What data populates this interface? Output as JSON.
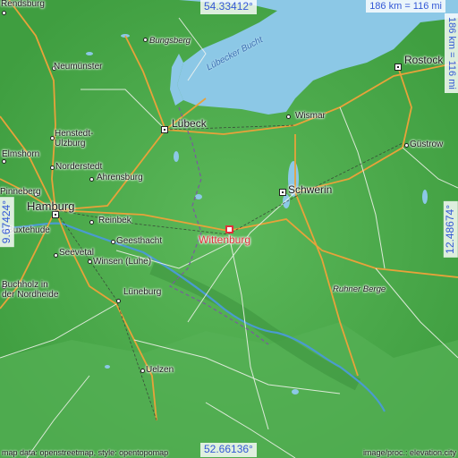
{
  "places": {
    "rendsburg": "Rendsburg",
    "bungsberg": "Bungsberg",
    "neumuenster": "Neumünster",
    "luebeck": "Lübeck",
    "henstedt": "Henstedt-\nUlzburg",
    "elmshorn": "Elmshorn",
    "norderstedt": "Norderstedt",
    "ahrensburg": "Ahrensburg",
    "pinneberg": "Pinneberg",
    "hamburg": "Hamburg",
    "buxtehude": "Buxtehude",
    "reinbek": "Reinbek",
    "geesthacht": "Geesthacht",
    "seevetal": "Seevetal",
    "winsen": "Winsen (Luhe)",
    "buchholz": "Buchholz in\nder Nordheide",
    "lueneburg": "Lüneburg",
    "uelzen": "Uelzen",
    "wismar": "Wismar",
    "rostock": "Rostock",
    "guestrow": "Güstrow",
    "schwerin": "Schwerin",
    "ruhner": "Ruhner Berge",
    "luebecker_bucht": "Lübecker Bucht",
    "wittenburg": "Wittenburg"
  },
  "coords": {
    "top": "54.33412°",
    "bottom": "52.66136°",
    "left": "9.67424°",
    "right": "12.48674°"
  },
  "scale": {
    "horizontal": "186 km = 116 mi",
    "vertical": "186 km = 116 mi"
  },
  "credits": {
    "left": "map data: openstreetmap, style: opentopomap",
    "right": "image/proc.: elevation.city"
  },
  "colors": {
    "sea": "#8cc8e6",
    "land": "#4aa84a",
    "target": "#e0303a",
    "coord_text": "#3358d6"
  }
}
